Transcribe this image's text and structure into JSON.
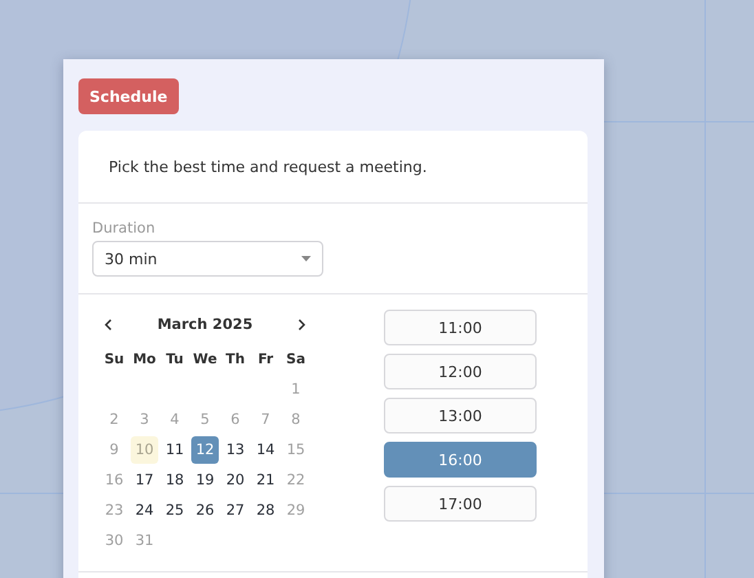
{
  "schedule_button": "Schedule",
  "intro": "Pick the best time and request a meeting.",
  "duration": {
    "label": "Duration",
    "value": "30 min"
  },
  "calendar": {
    "month": "March 2025",
    "weekdays": [
      "Su",
      "Mo",
      "Tu",
      "We",
      "Th",
      "Fr",
      "Sa"
    ],
    "weeks": [
      [
        {
          "day": "1",
          "kind": "disabled",
          "selected": false
        }
      ],
      [
        {
          "day": "2",
          "kind": "disabled",
          "selected": false
        },
        {
          "day": "3",
          "kind": "disabled",
          "selected": false
        },
        {
          "day": "4",
          "kind": "disabled",
          "selected": false
        },
        {
          "day": "5",
          "kind": "disabled",
          "selected": false
        },
        {
          "day": "6",
          "kind": "disabled",
          "selected": false
        },
        {
          "day": "7",
          "kind": "disabled",
          "selected": false
        },
        {
          "day": "8",
          "kind": "disabled",
          "selected": false
        }
      ],
      [
        {
          "day": "9",
          "kind": "disabled",
          "selected": false
        },
        {
          "day": "10",
          "kind": "today",
          "selected": false
        },
        {
          "day": "11",
          "kind": "available",
          "selected": false
        },
        {
          "day": "12",
          "kind": "available",
          "selected": true
        },
        {
          "day": "13",
          "kind": "available",
          "selected": false
        },
        {
          "day": "14",
          "kind": "available",
          "selected": false
        },
        {
          "day": "15",
          "kind": "disabled",
          "selected": false
        }
      ],
      [
        {
          "day": "16",
          "kind": "disabled",
          "selected": false
        },
        {
          "day": "17",
          "kind": "available",
          "selected": false
        },
        {
          "day": "18",
          "kind": "available",
          "selected": false
        },
        {
          "day": "19",
          "kind": "available",
          "selected": false
        },
        {
          "day": "20",
          "kind": "available",
          "selected": false
        },
        {
          "day": "21",
          "kind": "available",
          "selected": false
        },
        {
          "day": "22",
          "kind": "disabled",
          "selected": false
        }
      ],
      [
        {
          "day": "23",
          "kind": "disabled",
          "selected": false
        },
        {
          "day": "24",
          "kind": "available",
          "selected": false
        },
        {
          "day": "25",
          "kind": "available",
          "selected": false
        },
        {
          "day": "26",
          "kind": "available",
          "selected": false
        },
        {
          "day": "27",
          "kind": "available",
          "selected": false
        },
        {
          "day": "28",
          "kind": "available",
          "selected": false
        },
        {
          "day": "29",
          "kind": "disabled",
          "selected": false
        }
      ],
      [
        {
          "day": "30",
          "kind": "disabled",
          "selected": false
        },
        {
          "day": "31",
          "kind": "disabled",
          "selected": false
        }
      ]
    ]
  },
  "time_slots": [
    {
      "time": "11:00",
      "selected": false
    },
    {
      "time": "12:00",
      "selected": false
    },
    {
      "time": "13:00",
      "selected": false
    },
    {
      "time": "16:00",
      "selected": true
    },
    {
      "time": "17:00",
      "selected": false
    }
  ]
}
